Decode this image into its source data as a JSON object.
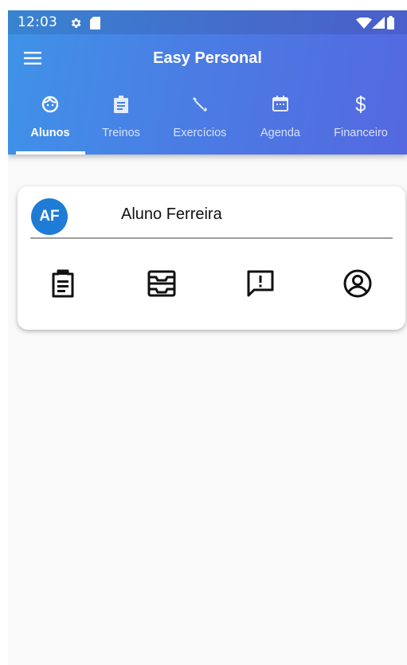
{
  "status_bar": {
    "time": "12:03",
    "icons": [
      "gear-icon",
      "sd-card-icon",
      "wifi-icon",
      "signal-icon",
      "battery-icon"
    ]
  },
  "app_bar": {
    "title": "Easy Personal",
    "menu_icon": "menu-icon"
  },
  "tabs": [
    {
      "label": "Alunos",
      "icon": "face-icon",
      "active": true
    },
    {
      "label": "Treinos",
      "icon": "clipboard-icon",
      "active": false
    },
    {
      "label": "Exercícios",
      "icon": "dumbbell-icon",
      "active": false
    },
    {
      "label": "Agenda",
      "icon": "calendar-icon",
      "active": false
    },
    {
      "label": "Financeiro",
      "icon": "dollar-icon",
      "active": false
    }
  ],
  "student_card": {
    "avatar_initials": "AF",
    "name": "Aluno Ferreira",
    "actions": [
      "clipboard-icon",
      "inbox-icon",
      "feedback-icon",
      "account-circle-icon"
    ]
  },
  "colors": {
    "appbar_gradient_start": "#3f93e8",
    "appbar_gradient_end": "#5468e0",
    "avatar_bg": "#1e7bd6",
    "background": "#f9f9f9"
  }
}
